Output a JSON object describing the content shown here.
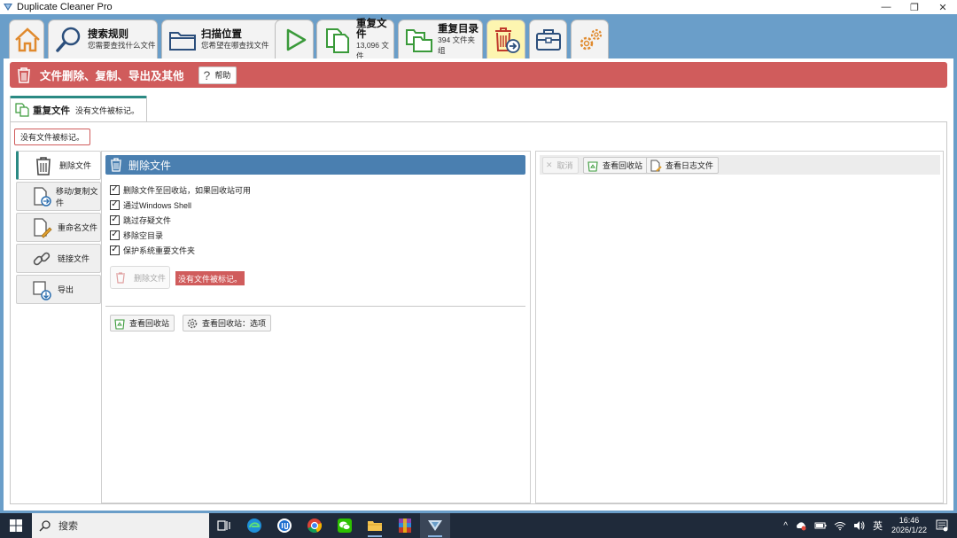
{
  "window": {
    "title": "Duplicate Cleaner Pro",
    "minimize": "—",
    "restore": "❐",
    "close": "✕"
  },
  "ribbon": {
    "tabs": [
      {
        "id": "home",
        "icon": "home-icon"
      },
      {
        "id": "search-rules",
        "icon": "magnifier-icon",
        "label": "搜索规则",
        "sub": "您需要查找什么文件"
      },
      {
        "id": "scan-location",
        "icon": "folder-icon",
        "label": "扫描位置",
        "sub": "您希望在哪查找文件"
      },
      {
        "id": "start",
        "icon": "play-icon"
      },
      {
        "id": "dup-files",
        "icon": "duplicate-files-icon",
        "label": "重复文件",
        "sub": "13,096 文件"
      },
      {
        "id": "dup-folders",
        "icon": "duplicate-folders-icon",
        "label": "重复目录",
        "sub": "394 文件夹组"
      },
      {
        "id": "file-removal",
        "icon": "trash-arrow-icon"
      },
      {
        "id": "tools",
        "icon": "toolbox-icon"
      },
      {
        "id": "settings",
        "icon": "gears-icon"
      }
    ]
  },
  "banner": {
    "title": "文件删除、复制、导出及其他",
    "help_label": "帮助",
    "help_glyph": "?"
  },
  "subtab": {
    "bold": "重复文件",
    "text": "没有文件被标记。"
  },
  "status_box": "没有文件被标记。",
  "leftnav": [
    {
      "label": "删除文件",
      "icon": "trash-icon",
      "active": true
    },
    {
      "label": "移动/复制文件",
      "icon": "file-move-icon",
      "active": false
    },
    {
      "label": "重命名文件",
      "icon": "file-rename-icon",
      "active": false
    },
    {
      "label": "链接文件",
      "icon": "link-icon",
      "active": false
    },
    {
      "label": "导出",
      "icon": "export-icon",
      "active": false
    }
  ],
  "delete_panel": {
    "header": "删除文件",
    "options": [
      {
        "label": "删除文件至回收站，如果回收站可用",
        "checked": true
      },
      {
        "label": "通过Windows Shell",
        "checked": true
      },
      {
        "label": "跳过存疑文件",
        "checked": true
      },
      {
        "label": "移除空目录",
        "checked": true
      },
      {
        "label": "保护系统重要文件夹",
        "checked": true
      }
    ],
    "delete_button": "删除文件",
    "badge": "没有文件被标记。",
    "view_recycle": "查看回收站",
    "recycle_options": "查看回收站：选项"
  },
  "right_panel": {
    "cancel": "取消",
    "view_recycle": "查看回收站",
    "view_log": "查看日志文件"
  },
  "taskbar": {
    "search": "搜索",
    "ime": "英",
    "time": "16:46",
    "date": "2026/1/22"
  }
}
